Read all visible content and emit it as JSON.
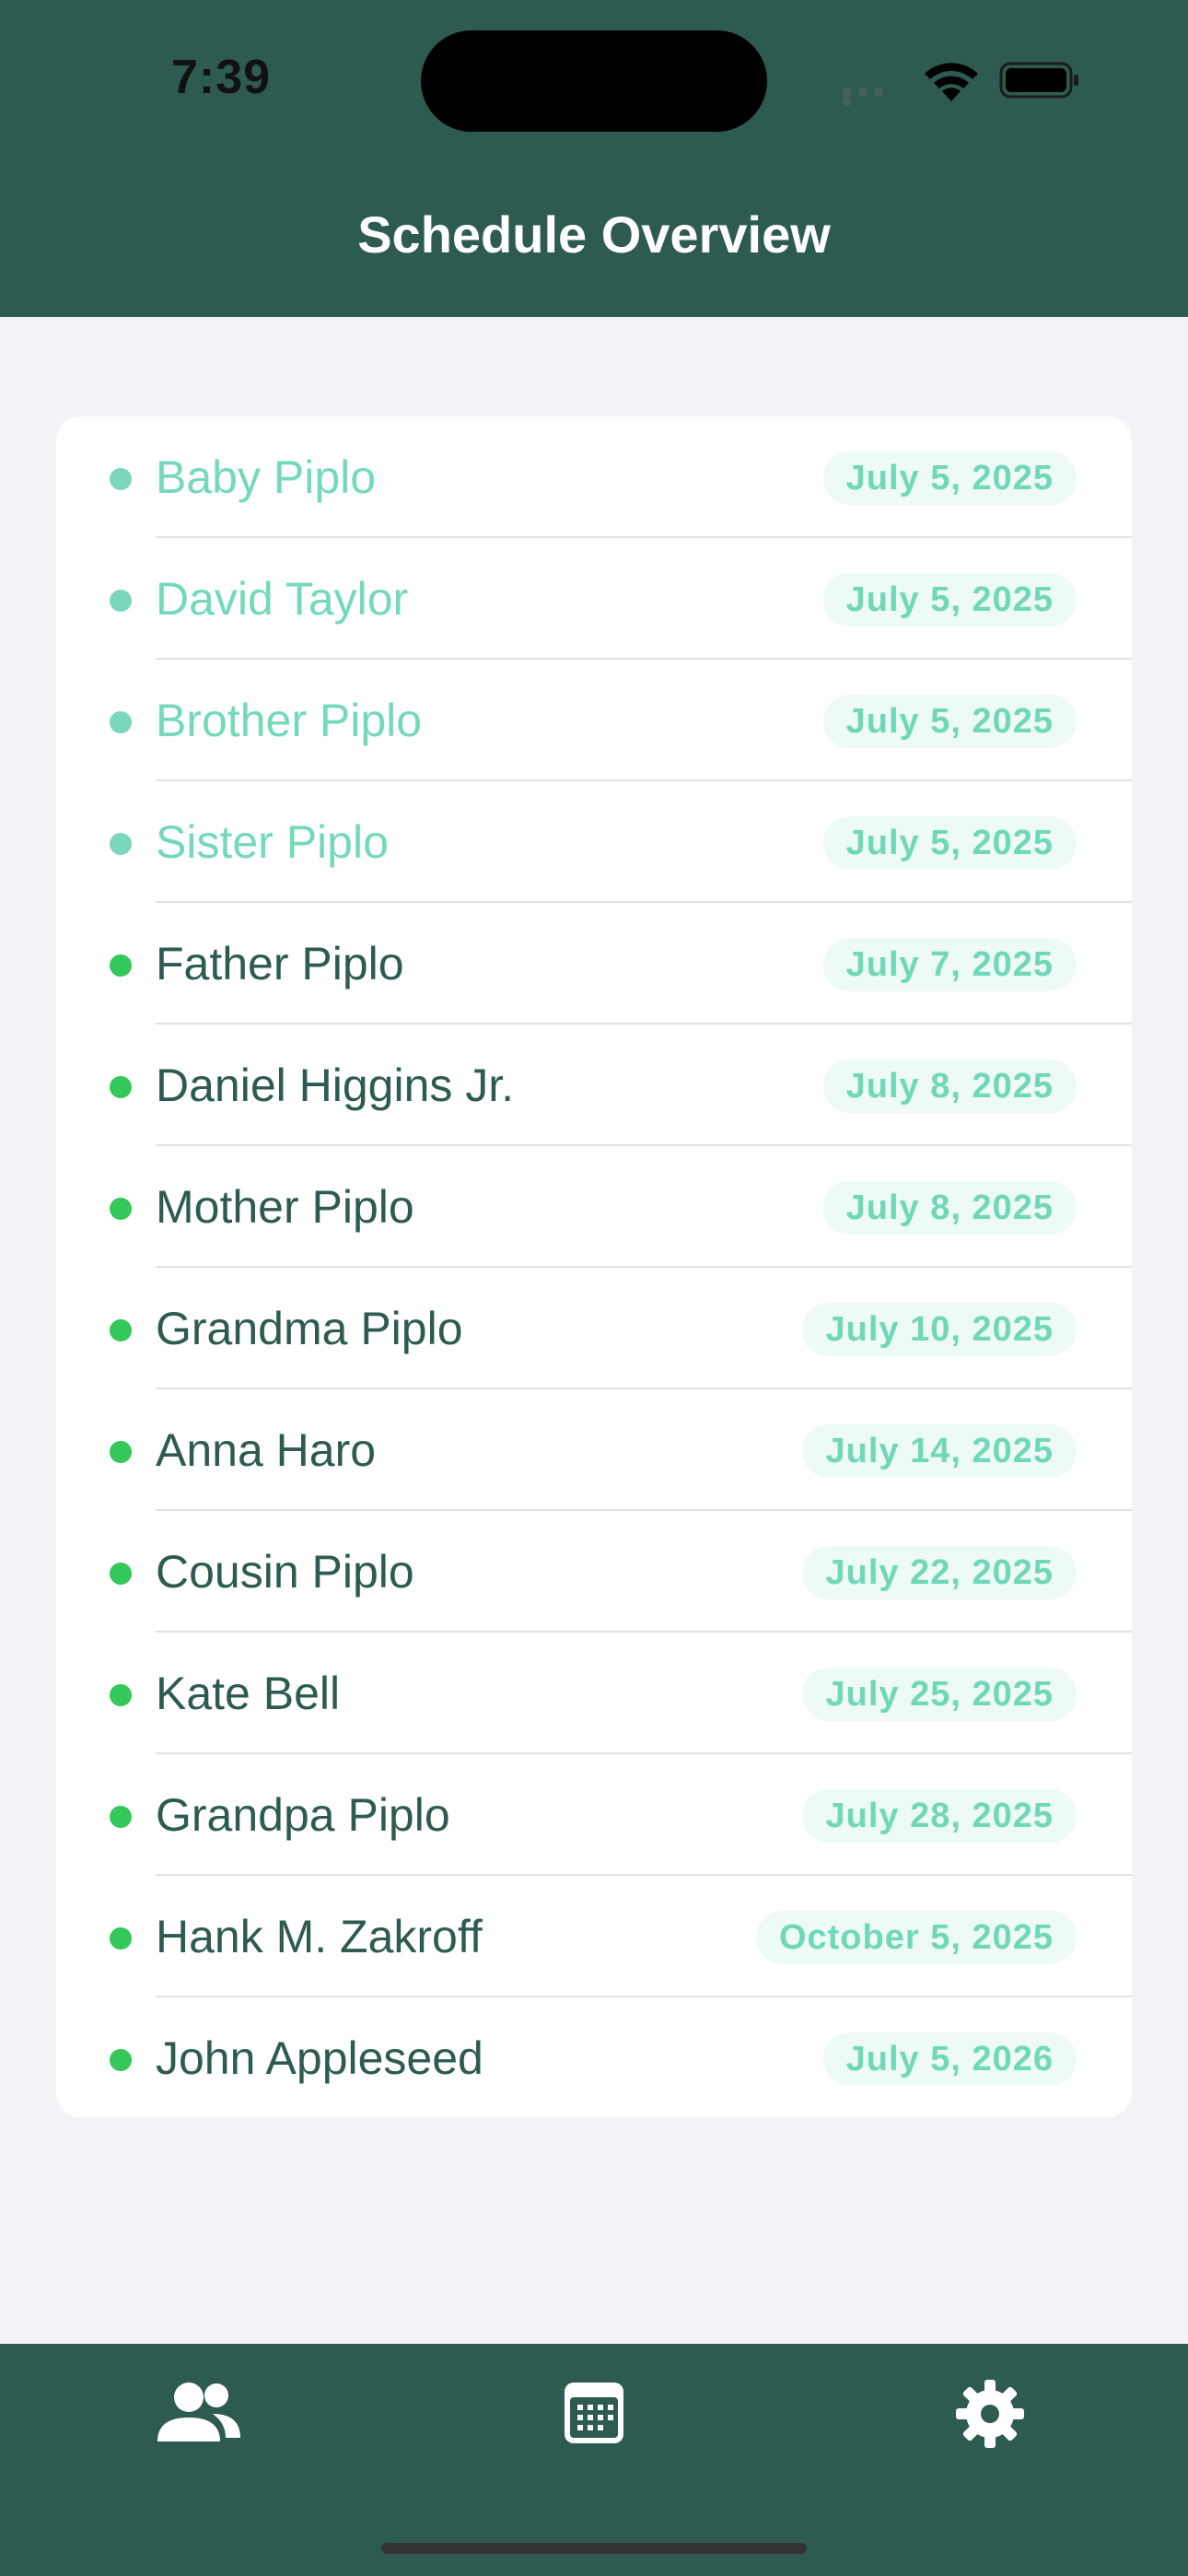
{
  "status_bar": {
    "time": "7:39",
    "icons": [
      "cellular-signal-icon",
      "wifi-icon",
      "battery-icon"
    ]
  },
  "header": {
    "title": "Schedule Overview",
    "background_color": "#2e5b51"
  },
  "colors": {
    "past_name": "#74d9bb",
    "past_dot": "#7bd7bb",
    "upcoming_name": "#2e5b51",
    "upcoming_dot": "#34c759",
    "date_text": "#6fd8b7",
    "date_pill": "#eefaf5"
  },
  "schedule": {
    "items": [
      {
        "name": "Baby Piplo",
        "date": "July 5, 2025",
        "status": "past"
      },
      {
        "name": "David Taylor",
        "date": "July 5, 2025",
        "status": "past"
      },
      {
        "name": "Brother Piplo",
        "date": "July 5, 2025",
        "status": "past"
      },
      {
        "name": "Sister Piplo",
        "date": "July 5, 2025",
        "status": "past"
      },
      {
        "name": "Father Piplo",
        "date": "July 7, 2025",
        "status": "upcoming"
      },
      {
        "name": "Daniel Higgins Jr.",
        "date": "July 8, 2025",
        "status": "upcoming"
      },
      {
        "name": "Mother Piplo",
        "date": "July 8, 2025",
        "status": "upcoming"
      },
      {
        "name": "Grandma Piplo",
        "date": "July 10, 2025",
        "status": "upcoming"
      },
      {
        "name": "Anna Haro",
        "date": "July 14, 2025",
        "status": "upcoming"
      },
      {
        "name": "Cousin Piplo",
        "date": "July 22, 2025",
        "status": "upcoming"
      },
      {
        "name": "Kate Bell",
        "date": "July 25, 2025",
        "status": "upcoming"
      },
      {
        "name": "Grandpa Piplo",
        "date": "July 28, 2025",
        "status": "upcoming"
      },
      {
        "name": "Hank M. Zakroff",
        "date": "October 5, 2025",
        "status": "upcoming"
      },
      {
        "name": "John Appleseed",
        "date": "July 5, 2026",
        "status": "upcoming"
      }
    ]
  },
  "tab_bar": {
    "tabs": [
      {
        "icon": "people-icon"
      },
      {
        "icon": "calendar-icon"
      },
      {
        "icon": "gear-icon"
      }
    ]
  }
}
